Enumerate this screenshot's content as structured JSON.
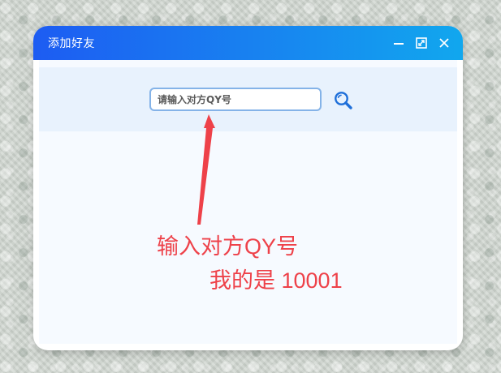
{
  "window": {
    "title": "添加好友"
  },
  "search": {
    "placeholder": "请输入对方QY号"
  },
  "annotations": {
    "line1": "输入对方QY号",
    "line2": "我的是 10001"
  },
  "colors": {
    "titlebar_start": "#1d5cf2",
    "titlebar_end": "#11a7ee",
    "annotation": "#ee4149",
    "search_border": "#84b3e8",
    "search_strip": "#e8f2fd"
  },
  "icons": {
    "minimize": "minimize-icon",
    "maximize": "maximize-icon",
    "close": "close-icon",
    "search": "search-icon"
  }
}
